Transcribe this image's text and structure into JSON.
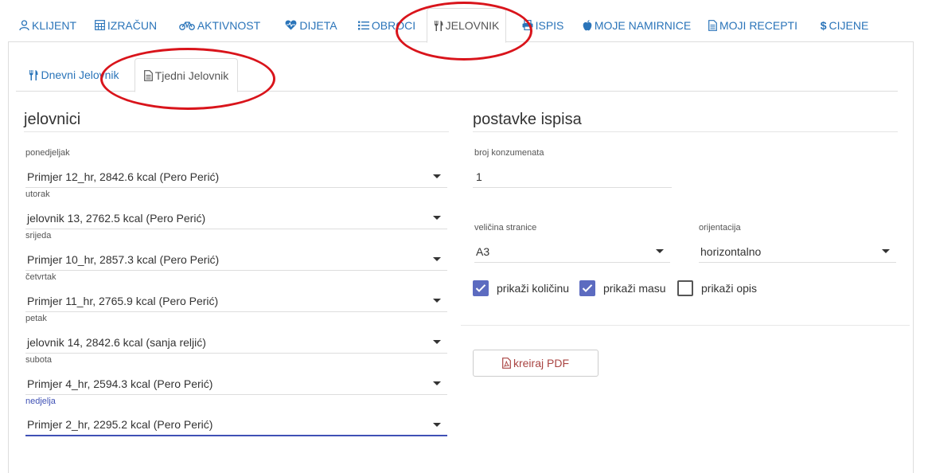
{
  "nav": {
    "items": [
      {
        "id": "klijent",
        "label": "KLIJENT",
        "icon": "user-icon"
      },
      {
        "id": "izracun",
        "label": "IZRAČUN",
        "icon": "calculator-icon"
      },
      {
        "id": "aktivnost",
        "label": "AKTIVNOST",
        "icon": "bicycle-icon"
      },
      {
        "id": "dijeta",
        "label": "DIJETA",
        "icon": "heartbeat-icon"
      },
      {
        "id": "obroci",
        "label": "OBROCI",
        "icon": "list-icon"
      },
      {
        "id": "jelovnik",
        "label": "JELOVNIK",
        "icon": "cutlery-icon",
        "active": true
      },
      {
        "id": "ispis",
        "label": "ISPIS",
        "icon": "print-icon"
      },
      {
        "id": "moje-namirnice",
        "label": "MOJE NAMIRNICE",
        "icon": "apple-icon"
      },
      {
        "id": "moji-recepti",
        "label": "MOJI RECEPTI",
        "icon": "document-icon"
      },
      {
        "id": "cijene",
        "label": "CIJENE",
        "icon": "dollar-icon"
      }
    ]
  },
  "subtabs": {
    "daily": "Dnevni Jelovnik",
    "weekly": "Tjedni Jelovnik",
    "active": "weekly"
  },
  "menus": {
    "title": "jelovnici",
    "days": [
      {
        "label": "ponedjeljak",
        "value": "Primjer 12_hr, 2842.6 kcal (Pero Perić)"
      },
      {
        "label": "utorak",
        "value": "jelovnik 13, 2762.5 kcal (Pero Perić)"
      },
      {
        "label": "srijeda",
        "value": "Primjer 10_hr, 2857.3 kcal (Pero Perić)"
      },
      {
        "label": "četvrtak",
        "value": "Primjer 11_hr, 2765.9 kcal (Pero Perić)"
      },
      {
        "label": "petak",
        "value": "jelovnik 14, 2842.6 kcal (sanja reljić)"
      },
      {
        "label": "subota",
        "value": "Primjer 4_hr, 2594.3 kcal (Pero Perić)"
      },
      {
        "label": "nedjelja",
        "value": "Primjer 2_hr, 2295.2 kcal (Pero Perić)",
        "focused": true
      }
    ]
  },
  "print": {
    "title": "postavke ispisa",
    "consumers_label": "broj konzumenata",
    "consumers_value": "1",
    "page_size_label": "veličina stranice",
    "page_size_value": "A3",
    "orientation_label": "orijentacija",
    "orientation_value": "horizontalno",
    "show_quantity_label": "prikaži količinu",
    "show_quantity_checked": true,
    "show_mass_label": "prikaži masu",
    "show_mass_checked": true,
    "show_description_label": "prikaži opis",
    "show_description_checked": false,
    "pdf_button": "kreiraj PDF"
  },
  "colors": {
    "link": "#2a74b9",
    "accent": "#3f51b5",
    "checkbox": "#5c6bc0",
    "pdf_text": "#a94442",
    "annotation": "#d9141b"
  }
}
